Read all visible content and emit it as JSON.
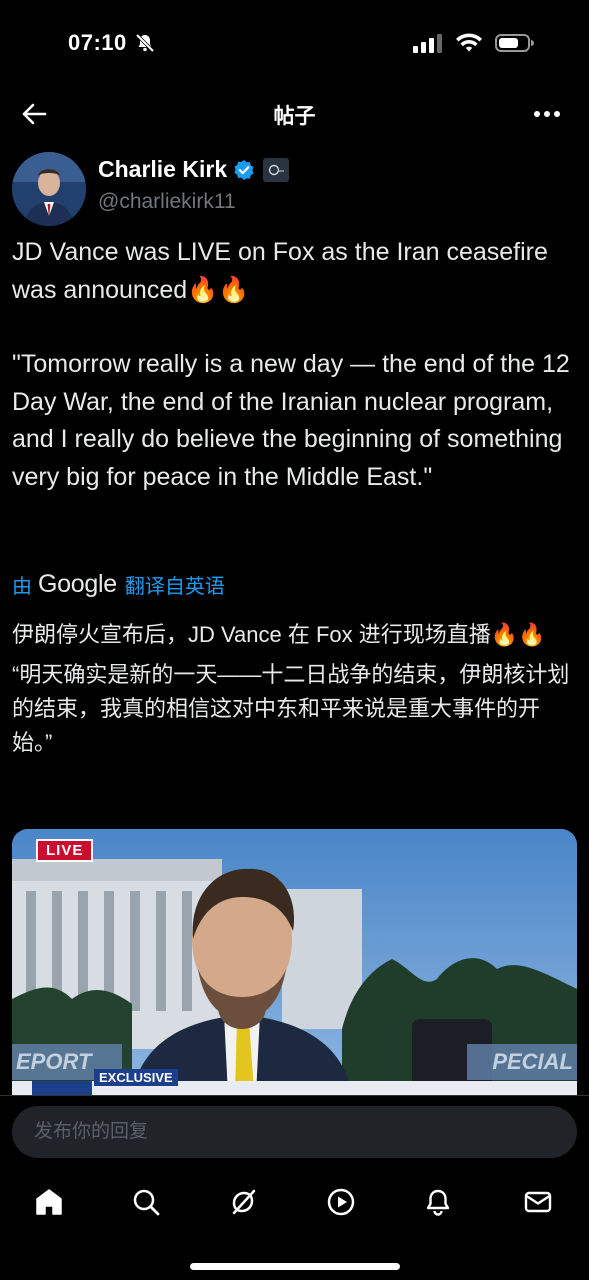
{
  "status_bar": {
    "time": "07:10"
  },
  "header": {
    "title": "帖子"
  },
  "author": {
    "name": "Charlie Kirk",
    "handle": "@charliekirk11"
  },
  "post": {
    "text_line1": "JD Vance was LIVE on Fox as the Iran ceasefire was announced🔥🔥",
    "text_quote": "\"Tomorrow really is a new day — the end of the 12 Day War, the end of the Iranian nuclear program, and I really do believe the beginning of something very big for peace in the Middle East.\""
  },
  "translation": {
    "prefix": "由",
    "provider": "Google",
    "suffix": "翻译自英语",
    "text_line1": "伊朗停火宣布后，JD Vance 在 Fox 进行现场直播🔥🔥",
    "text_quote": "“明天确实是新的一天——十二日战争的结束，伊朗核计划的结束，我真的相信这对中东和平来说是重大事件的开始。”"
  },
  "media": {
    "live_label": "LIVE",
    "exclusive_label": "EXCLUSIVE",
    "left_ticker": "EPORT",
    "right_ticker": "PECIAL"
  },
  "reply": {
    "placeholder": "发布你的回复"
  },
  "nav": {
    "items": [
      "home-icon",
      "search-icon",
      "grok-icon",
      "video-icon",
      "notifications-icon",
      "messages-icon"
    ]
  },
  "colors": {
    "background": "#000000",
    "text": "#e7e9ea",
    "secondary": "#71767b",
    "accent": "#1d9bf0",
    "live_red": "#c8102e"
  }
}
